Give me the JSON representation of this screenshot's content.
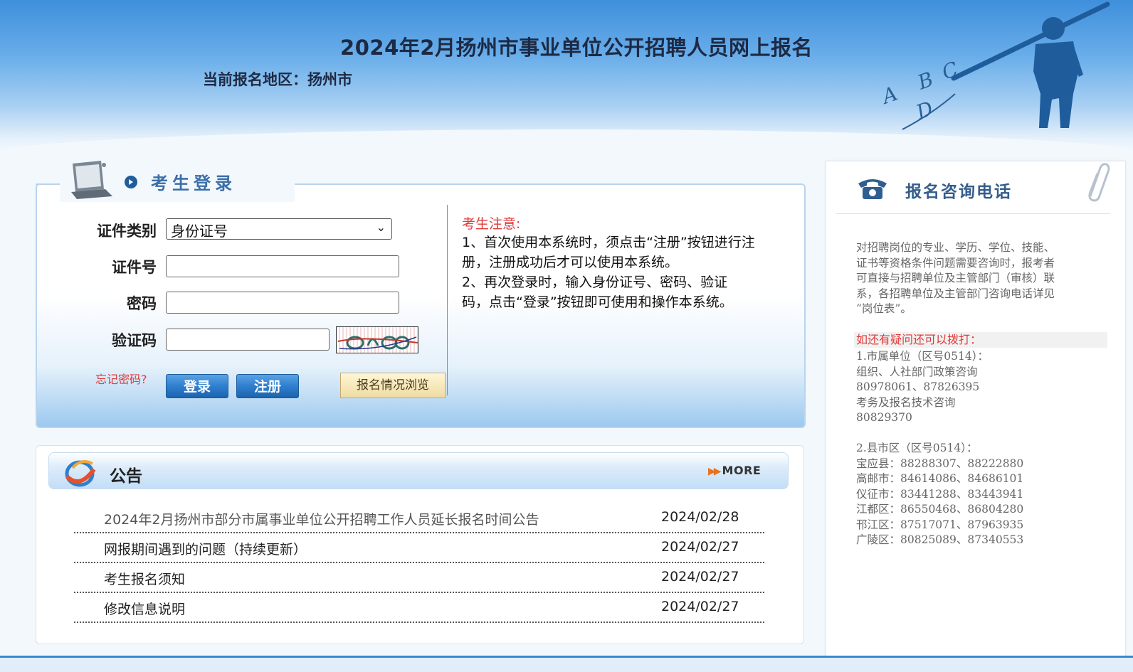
{
  "header": {
    "title": "2024年2月扬州市事业单位公开招聘人员网上报名",
    "region_label": "当前报名地区：",
    "region_value": "扬州市"
  },
  "login": {
    "section_title": "考生登录",
    "id_type_label": "证件类别",
    "id_type_value": "身份证号",
    "id_number_label": "证件号",
    "password_label": "密码",
    "captcha_label": "验证码",
    "forgot_label": "忘记密码?",
    "login_button": "登录",
    "register_button": "注册",
    "browse_button": "报名情况浏览",
    "notice_title": "考生注意:",
    "notice_lines": [
      "1、首次使用本系统时，须点击“注册”按钮进行注",
      "册，注册成功后才可以使用本系统。",
      "2、再次登录时，输入身份证号、密码、验证",
      "码，点击“登录”按钮即可使用和操作本系统。"
    ]
  },
  "announcements": {
    "title": "公告",
    "more_label": "MORE",
    "items": [
      {
        "title": "2024年2月扬州市部分市属事业单位公开招聘工作人员延长报名时间公告",
        "date": "2024/02/28"
      },
      {
        "title": "网报期间遇到的问题（持续更新）",
        "date": "2024/02/27"
      },
      {
        "title": "考生报名须知",
        "date": "2024/02/27"
      },
      {
        "title": "修改信息说明",
        "date": "2024/02/27"
      }
    ]
  },
  "contact": {
    "title": "报名咨询电话",
    "intro": [
      "对招聘岗位的专业、学历、学位、技能、",
      "证书等资格条件问题需要咨询时，报考者",
      "可直接与招聘单位及主管部门（审核）联",
      "系，各招聘单位及主管部门咨询电话详见",
      "“岗位表”。"
    ],
    "red_line": "如还有疑问还可以拨打：",
    "city_lines": [
      "1.市属单位（区号0514）：",
      "组织、人社部门政策咨询",
      "80978061、87826395",
      "考务及报名技术咨询",
      "80829370"
    ],
    "county_lines": [
      "2.县市区（区号0514）：",
      "宝应县：88288307、88222880",
      "高邮市：84614086、84686101",
      "仪征市：83441288、83443941",
      "江都区：86550468、86804280",
      "邗江区：87517071、87963935",
      "广陵区：80825089、87340553"
    ]
  },
  "colors": {
    "brand_blue": "#2f7fcf",
    "notice_red": "#e03a3a",
    "header_blue": "#3f8fdc"
  },
  "icons": [
    "laptop-icon",
    "arrow-circle-icon",
    "phone-icon",
    "paperclip-icon",
    "announcement-logo-icon",
    "more-arrow-icon",
    "chevron-down-icon"
  ]
}
